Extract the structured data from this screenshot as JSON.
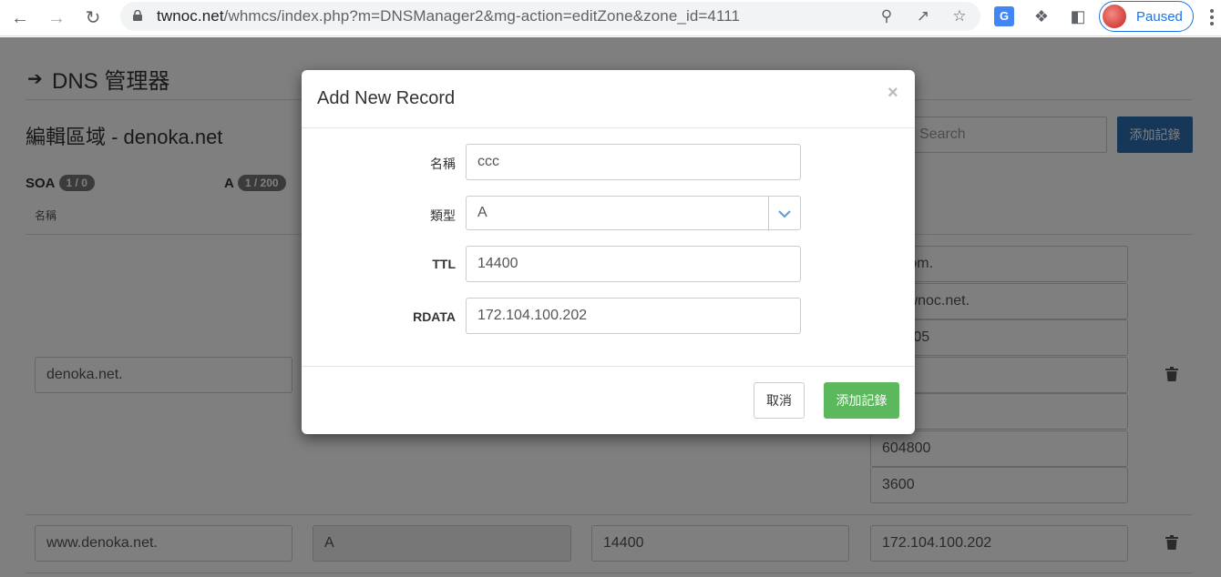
{
  "browser": {
    "url_host": "twnoc.net",
    "url_path": "/whmcs/index.php?m=DNSManager2&mg-action=editZone&zone_id=4111",
    "profile_status": "Paused"
  },
  "page": {
    "title": "DNS 管理器",
    "zone_title": "編輯區域 - denoka.net",
    "search_placeholder": "Search",
    "add_record_label": "添加記錄",
    "tabs": [
      {
        "label": "SOA",
        "count": "1 / 0"
      },
      {
        "label": "A",
        "count": "1 / 200"
      }
    ],
    "column_name_header": "名稱",
    "soa_row": {
      "name": "denoka.net.",
      "rdata_values": [
        "ns.com.",
        "ort.twnoc.net.",
        "011705",
        "0",
        "",
        "604800",
        "3600"
      ]
    },
    "a_row": {
      "name": "www.denoka.net.",
      "type": "A",
      "ttl": "14400",
      "rdata": "172.104.100.202"
    }
  },
  "modal": {
    "title": "Add New Record",
    "close_glyph": "×",
    "fields": {
      "name_label": "名稱",
      "name_value": "ccc",
      "type_label": "類型",
      "type_value": "A",
      "ttl_label": "TTL",
      "ttl_value": "14400",
      "rdata_label": "RDATA",
      "rdata_value": "172.104.100.202"
    },
    "cancel_label": "取消",
    "submit_label": "添加記錄"
  },
  "colors": {
    "primary": "#2c6fb0",
    "success": "#5cb85c",
    "profile_blue": "#1a73e8"
  },
  "icons": [
    "back-icon",
    "forward-icon",
    "reload-icon",
    "lock-icon",
    "zoom-icon",
    "share-icon",
    "star-icon",
    "translate-icon",
    "extensions-icon",
    "sidepanel-icon",
    "menu-icon",
    "arrow-left-icon",
    "trash-icon",
    "chevron-down-icon"
  ]
}
